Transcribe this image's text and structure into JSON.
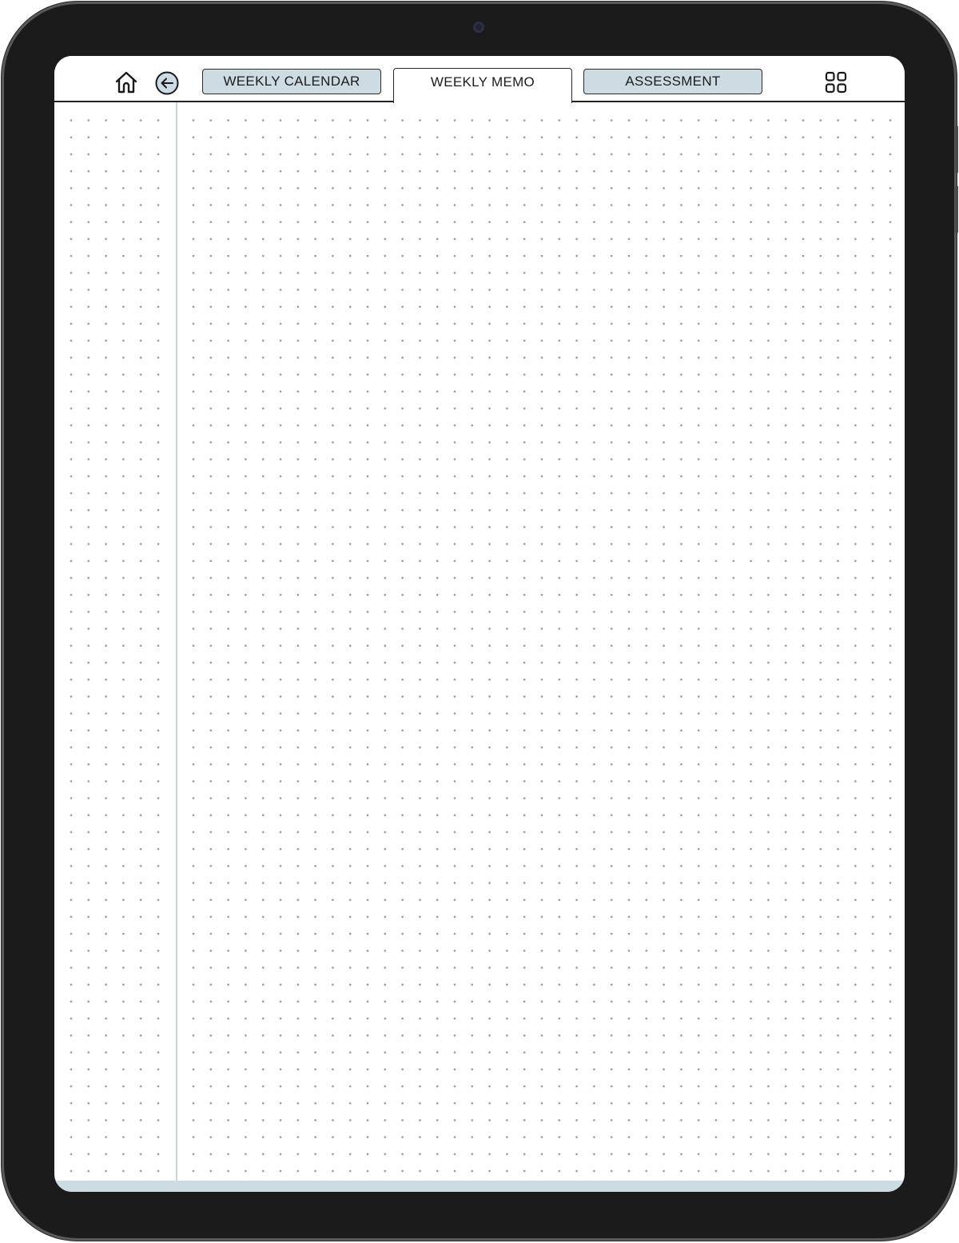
{
  "nav": {
    "home_icon": "home-icon",
    "back_icon": "arrow-left-circle-icon",
    "grid_icon": "grid-icon"
  },
  "tabs": [
    {
      "label": "WEEKLY CALENDAR",
      "active": false
    },
    {
      "label": "WEEKLY MEMO",
      "active": true
    },
    {
      "label": "ASSESSMENT",
      "active": false
    }
  ],
  "colors": {
    "tab_fill": "#cddbe3",
    "dot": "#9a9a9a",
    "divider": "#c9d4db",
    "bezel": "#1b1b1b"
  },
  "page": {
    "pattern": "dot-grid"
  }
}
